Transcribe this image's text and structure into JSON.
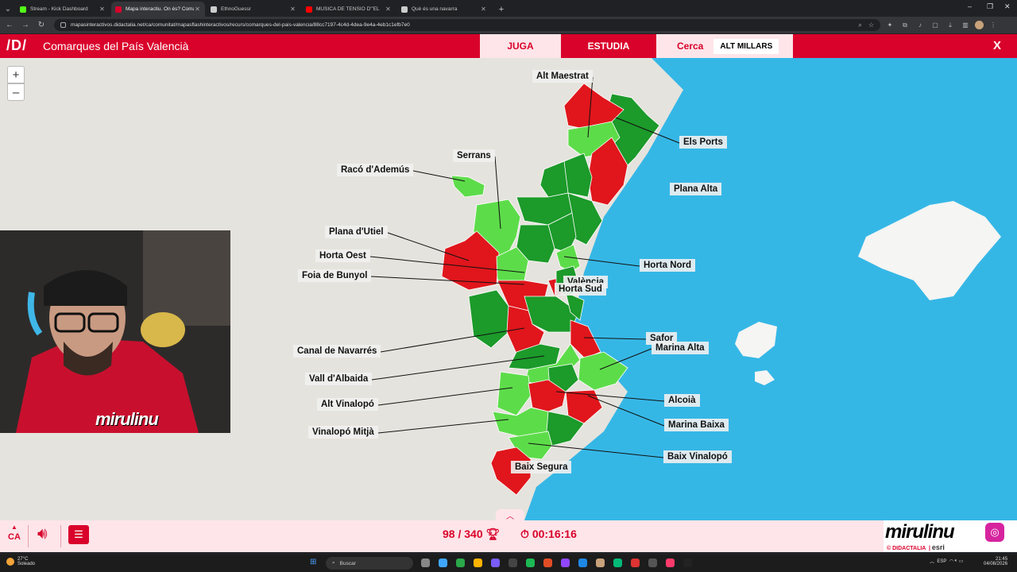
{
  "browser": {
    "tabs": [
      {
        "title": "Stream - Kick Dashboard",
        "active": false,
        "favicon_color": "#53fc18"
      },
      {
        "title": "Mapa interactiu. On és? Comar",
        "active": true,
        "favicon_color": "#d9022b"
      },
      {
        "title": "EthnoGuessr",
        "active": false,
        "favicon_color": "#cccccc"
      },
      {
        "title": "MÚSICA DE TENSIÓ D'\"EL",
        "active": false,
        "favicon_color": "#ff0000"
      },
      {
        "title": "Què és una navarra",
        "active": false,
        "favicon_color": "#cccccc"
      }
    ],
    "url": "mapasinteractivos.didactalia.net/ca/comunitat/mapasflashinteractivos/recurs/comarques-del-pais-valencia/88cc7197-4c4d-4dea-9e4a-4eb1c1efb7e0"
  },
  "header": {
    "logo": "/D/",
    "title": "Comarques del País Valencià",
    "tabs": {
      "play": "JUGA",
      "study": "ESTUDIA",
      "search": "Cerca"
    },
    "target": "ALT MILLARS",
    "close": "X"
  },
  "map": {
    "zoom_in": "+",
    "zoom_out": "–",
    "labels": [
      {
        "text": "Alt Maestrat"
      },
      {
        "text": "Els Ports"
      },
      {
        "text": "Plana Alta"
      },
      {
        "text": "Serrans"
      },
      {
        "text": "Racó d'Ademús"
      },
      {
        "text": "Plana d'Utiel"
      },
      {
        "text": "Horta Oest"
      },
      {
        "text": "Foia de Bunyol"
      },
      {
        "text": "Horta Nord"
      },
      {
        "text": "València"
      },
      {
        "text": "Horta Sud"
      },
      {
        "text": "Safor"
      },
      {
        "text": "Marina Alta"
      },
      {
        "text": "Canal de Navarrés"
      },
      {
        "text": "Vall d'Albaida"
      },
      {
        "text": "Alt Vinalopó"
      },
      {
        "text": "Alcoià"
      },
      {
        "text": "Marina Baixa"
      },
      {
        "text": "Vinalopó Mitjà"
      },
      {
        "text": "Baix Vinalopó"
      },
      {
        "text": "Baix Segura"
      }
    ],
    "colors": {
      "correct": "#1c9a2a",
      "light": "#5ddc4a",
      "wrong": "#e0161c",
      "sea": "#35b7e6",
      "land": "#e5e3dd"
    }
  },
  "webcam": {
    "watermark": "mirulinu"
  },
  "footer": {
    "language": "CA",
    "score": "98 / 340",
    "timer": "00:16:16",
    "brand": "mirulinu",
    "credits": "© DIDACTALIA",
    "esri": "esri"
  },
  "taskbar": {
    "temp": "27°C",
    "weather": "Soleado",
    "search": "Buscar",
    "lang": "ESP",
    "time": "21:45",
    "date": "04/08/2026"
  }
}
